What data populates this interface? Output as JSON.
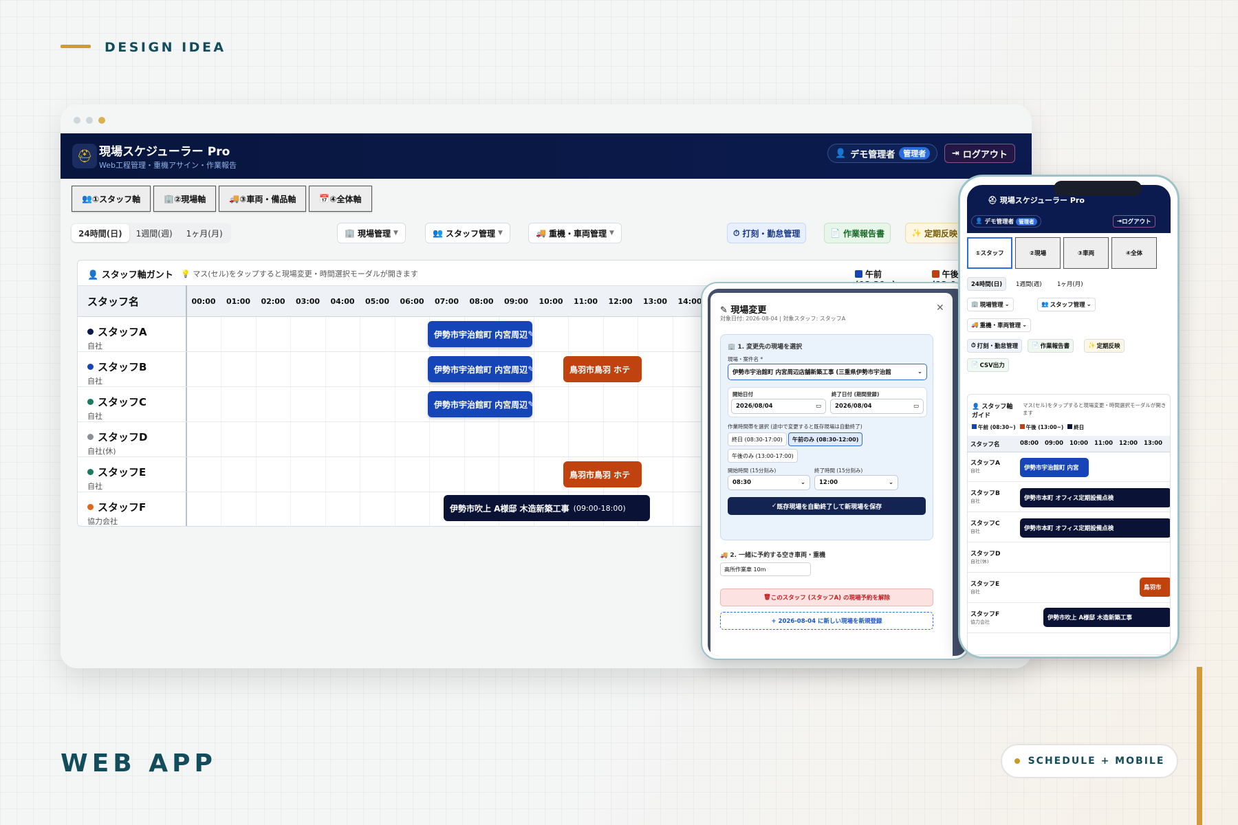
{
  "header": {
    "design_label": "DESIGN IDEA",
    "bottom_label": "WEB APP",
    "pill_label": "SCHEDULE + MOBILE"
  },
  "colors": {
    "navy": "#0b1b4f",
    "am": "#1645b8",
    "pm": "#c0420e",
    "full": "#0a1236",
    "accent_gold": "#d29a36",
    "teal": "#134c5b"
  },
  "app": {
    "title": "現場スケジューラー Pro",
    "subtitle": "Web工程管理・重機アサイン・作業報告",
    "user": "デモ管理者",
    "role_badge": "管理者",
    "logout": "ログアウト"
  },
  "axis_tabs": [
    "①スタッフ軸",
    "②現場軸",
    "③車両・備品軸",
    "④全体軸"
  ],
  "range_tabs": [
    "24時間(日)",
    "1週間(週)",
    "1ヶ月(月)"
  ],
  "menus": {
    "site_mgmt": "現場管理",
    "staff_mgmt": "スタッフ管理",
    "vehicle_mgmt": "重機・車両管理",
    "attendance": "打刻・勤怠管理",
    "report": "作業報告書",
    "recurring": "定期反映",
    "csv": "CSV出力"
  },
  "gantt": {
    "caption": "スタッフ軸ガント",
    "hint": "マス(セル)をタップすると現場変更・時間選択モーダルが開きます",
    "legend_am": "午前 (08:30~)",
    "legend_pm": "午後 (13:0",
    "name_header": "スタッフ名",
    "hours": [
      "00:00",
      "01:00",
      "02:00",
      "03:00",
      "04:00",
      "05:00",
      "06:00",
      "07:00",
      "08:00",
      "09:00",
      "10:00",
      "11:00",
      "12:00",
      "13:00",
      "14:00"
    ],
    "staff": [
      {
        "name": "スタッフA",
        "company": "自社",
        "dot": "#0a1a4a"
      },
      {
        "name": "スタッフB",
        "company": "自社",
        "dot": "#1645b8"
      },
      {
        "name": "スタッフC",
        "company": "自社",
        "dot": "#1a7a5e"
      },
      {
        "name": "スタッフD",
        "company": "自社(休)",
        "dot": "#8a8f96"
      },
      {
        "name": "スタッフE",
        "company": "自社",
        "dot": "#1a7a5e"
      },
      {
        "name": "スタッフF",
        "company": "協力会社",
        "dot": "#e0661a"
      }
    ],
    "bars": {
      "a_am": "伊勢市宇治館町 内宮周辺",
      "b_am": "伊勢市宇治館町 内宮周辺",
      "b_pm": "鳥羽市鳥羽 ホテ",
      "c_am": "伊勢市宇治館町 内宮周辺",
      "e_pm": "鳥羽市鳥羽 ホテ",
      "f_full": "伊勢市吹上 A様邸 木造新築工事",
      "f_time": "(09:00-18:00)"
    }
  },
  "modal": {
    "title": "現場変更",
    "subtitle": "対象日付: 2026-08-04 | 対象スタッフ: スタッフA",
    "section1": "1. 変更先の現場を選択",
    "site_label": "現場・案件名 *",
    "site_value": "伊勢市宇治館町 内宮周辺店舗新築工事 (三重県伊勢市宇治館",
    "start_date_label": "開始日付",
    "end_date_label": "終了日付 (期間登録)",
    "start_date": "2026/08/04",
    "end_date": "2026/08/04",
    "slot_label": "作業時間帯を選択 (途中で変更すると既存現場は自動終了)",
    "slot_full": "終日 (08:30-17:00)",
    "slot_am": "午前のみ (08:30-12:00)",
    "slot_pm": "午後のみ (13:00-17:00)",
    "start_time_label": "開始時間 (15分刻み)",
    "end_time_label": "終了時間 (15分刻み)",
    "start_time": "08:30",
    "end_time": "12:00",
    "save": "既存現場を自動終了して新現場を保存",
    "section2": "2. 一緒に予約する空き車両・重機",
    "vehicle": "高所作業車 10m",
    "delete": "このスタッフ (スタッフA) の現場予約を解除",
    "new_reg": "+ 2026-08-04 に新しい現場を新規登録"
  },
  "phone": {
    "title": "現場スケジューラー Pro",
    "user": "デモ管理者",
    "badge": "管理者",
    "logout": "ログアウト",
    "axis": [
      "①スタッフ",
      "②現場",
      "③車両",
      "④全体"
    ],
    "guide_title": "スタッフ軸ガイド",
    "guide_hint": "マス(セル)をタップすると現場変更・時間選択モーダルが開きます",
    "legend_am": "午前 (08:30~)",
    "legend_pm": "午後 (13:00~)",
    "legend_full": "終日",
    "name_header": "スタッフ名",
    "hours": [
      "08:00",
      "09:00",
      "10:00",
      "11:00",
      "12:00",
      "13:00"
    ],
    "bars": {
      "a": "伊勢市宇治館町 内宮",
      "b": "伊勢市本町 オフィス定期設備点検",
      "c": "伊勢市本町 オフィス定期設備点検",
      "e": "鳥羽市",
      "f": "伊勢市吹上 A様邸 木造新築工事"
    }
  }
}
